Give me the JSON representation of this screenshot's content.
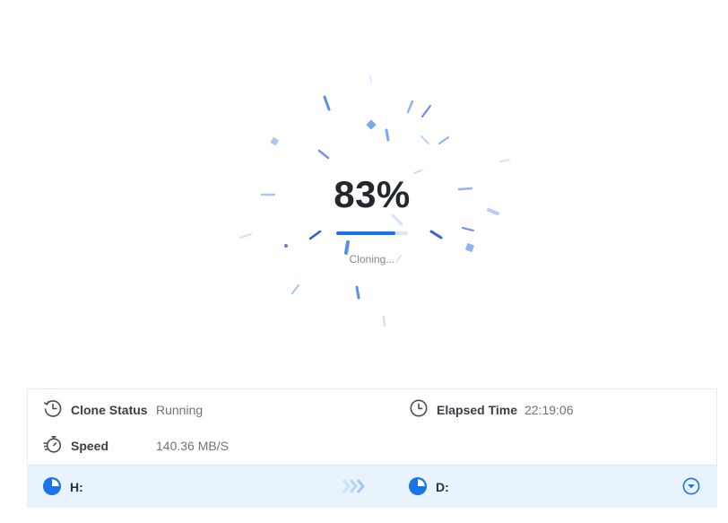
{
  "progress": {
    "percent_label": "83%",
    "percent": 83,
    "status_text": "Cloning..."
  },
  "info": {
    "clone_status_label": "Clone Status",
    "clone_status_value": "Running",
    "speed_label": "Speed",
    "speed_value": "140.36 MB/S",
    "elapsed_label": "Elapsed Time",
    "elapsed_value": "22:19:06"
  },
  "drives": {
    "source": "H:",
    "target": "D:"
  },
  "icons": {
    "clone_status": "clock-history-icon",
    "speed": "stopwatch-icon",
    "elapsed": "clock-icon",
    "source_drive": "pie-chart-icon",
    "target_drive": "pie-chart-icon",
    "arrows": "chevrons-right-icon",
    "expand": "chevron-down-circle-icon"
  },
  "colors": {
    "accent": "#1a73e8",
    "drive_bar_bg": "#e8f3fd",
    "track": "#dfe6ef"
  }
}
